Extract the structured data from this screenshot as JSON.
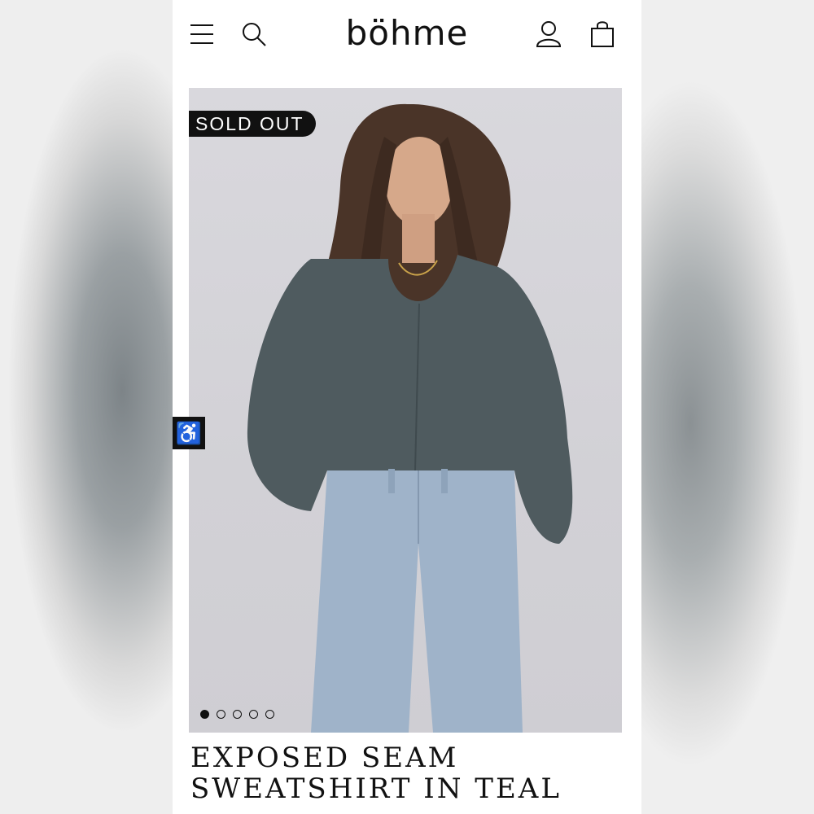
{
  "header": {
    "logo": "böhme",
    "icons": [
      "menu-icon",
      "search-icon",
      "account-icon",
      "cart-icon"
    ]
  },
  "product": {
    "badge": "SOLD OUT",
    "title_line1": "EXPOSED SEAM",
    "title_line2": "SWEATSHIRT IN TEAL",
    "image_count": 5,
    "active_image": 1
  },
  "accessibility": {
    "icon": "accessibility-icon",
    "glyph": "♿"
  },
  "colors": {
    "badge_bg": "#111111",
    "sweatshirt": "#4f5b5f",
    "jeans": "#9fb3c9"
  }
}
